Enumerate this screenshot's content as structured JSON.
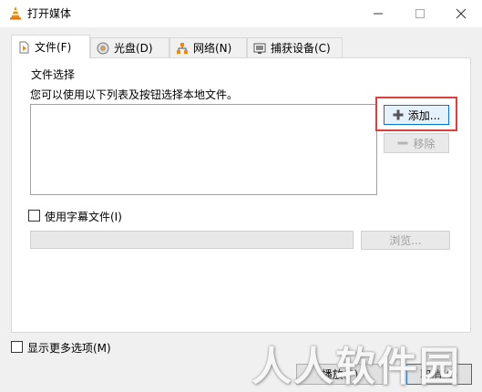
{
  "window": {
    "title": "打开媒体",
    "icon": "vlc-cone-icon",
    "controls": {
      "minimize": "—",
      "maximize": "☐",
      "close": "✕"
    }
  },
  "tabs": [
    {
      "label": "文件(F)",
      "icon": "file-icon",
      "active": true
    },
    {
      "label": "光盘(D)",
      "icon": "disc-icon",
      "active": false
    },
    {
      "label": "网络(N)",
      "icon": "network-icon",
      "active": false
    },
    {
      "label": "捕获设备(C)",
      "icon": "capture-device-icon",
      "active": false
    }
  ],
  "file_selection": {
    "group_title": "文件选择",
    "instruction": "您可以使用以下列表及按钮选择本地文件。",
    "files": [],
    "add_label": "添加...",
    "remove_label": "移除"
  },
  "subtitle": {
    "checkbox_label": "使用字幕文件(I)",
    "checked": false,
    "path_value": "",
    "browse_label": "浏览..."
  },
  "footer": {
    "more_options_label": "显示更多选项(M)",
    "more_options_checked": false,
    "play_label": "播放(P)",
    "cancel_label": "取消(C)"
  },
  "watermark": "人人软件园",
  "colors": {
    "highlight_border": "#d9423c",
    "focus_blue": "#0078d7",
    "vlc_orange": "#f28a00"
  }
}
